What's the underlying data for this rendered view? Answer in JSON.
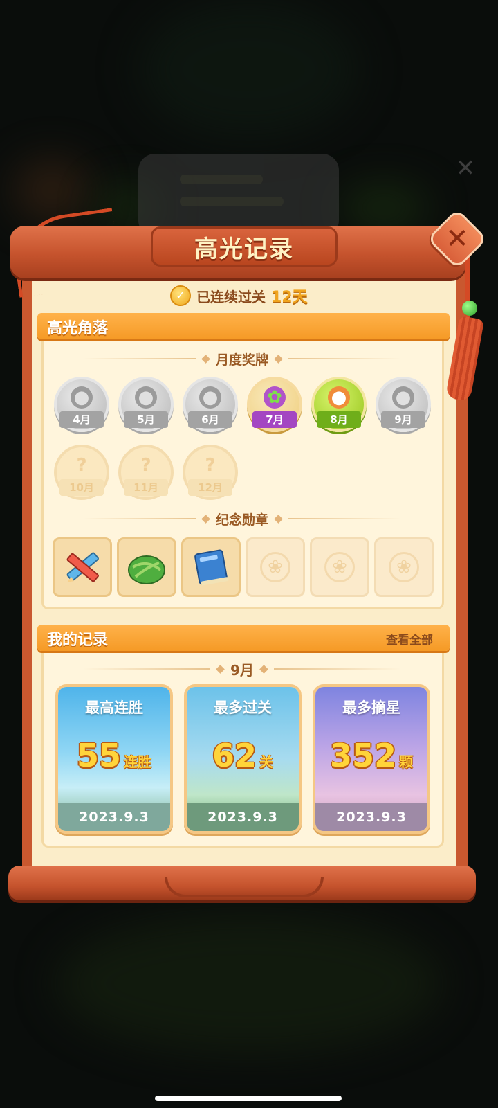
{
  "title": "高光记录",
  "streak": {
    "label": "已连续过关",
    "value": "12天"
  },
  "highlights": {
    "section_title": "高光角落",
    "monthly_medals_header": "月度奖牌",
    "medals": [
      {
        "label": "4月",
        "state": "gray",
        "icon": "tomato-icon",
        "glyph": "●"
      },
      {
        "label": "5月",
        "state": "gray",
        "icon": "cow-icon",
        "glyph": "●"
      },
      {
        "label": "6月",
        "state": "gray",
        "icon": "peach-icon",
        "glyph": "●"
      },
      {
        "label": "7月",
        "state": "purple",
        "icon": "mangosteen-icon",
        "glyph": "✿"
      },
      {
        "label": "8月",
        "state": "green",
        "icon": "coconut-icon",
        "glyph": "●"
      },
      {
        "label": "9月",
        "state": "gray",
        "icon": "cat-icon",
        "glyph": "●"
      },
      {
        "label": "10月",
        "state": "locked",
        "icon": "question-icon",
        "glyph": "?"
      },
      {
        "label": "11月",
        "state": "locked",
        "icon": "question-icon",
        "glyph": "?"
      },
      {
        "label": "12月",
        "state": "locked",
        "icon": "question-icon",
        "glyph": "?"
      }
    ],
    "commemorative_header": "纪念勋章",
    "badges": [
      {
        "icon": "pencil-ruler-icon",
        "locked": false
      },
      {
        "icon": "zongzi-icon",
        "locked": false
      },
      {
        "icon": "book-icon",
        "locked": false
      },
      {
        "icon": "paw-icon",
        "locked": true
      },
      {
        "icon": "paw-icon",
        "locked": true
      },
      {
        "icon": "paw-icon",
        "locked": true
      }
    ]
  },
  "records": {
    "section_title": "我的记录",
    "view_all": "查看全部",
    "month": "9月",
    "cards": [
      {
        "title": "最高连胜",
        "value": "55",
        "unit": "连胜",
        "date": "2023.9.3",
        "theme": "#6fc7ef"
      },
      {
        "title": "最多过关",
        "value": "62",
        "unit": "关",
        "date": "2023.9.3",
        "theme": "#8fd0e8"
      },
      {
        "title": "最多摘星",
        "value": "352",
        "unit": "颗",
        "date": "2023.9.3",
        "theme": "#b9a3e6"
      }
    ]
  },
  "colors": {
    "frame": "#c9582f",
    "paper": "#fbedc9",
    "accent": "#f59a26",
    "gold": "#ffd43a"
  }
}
